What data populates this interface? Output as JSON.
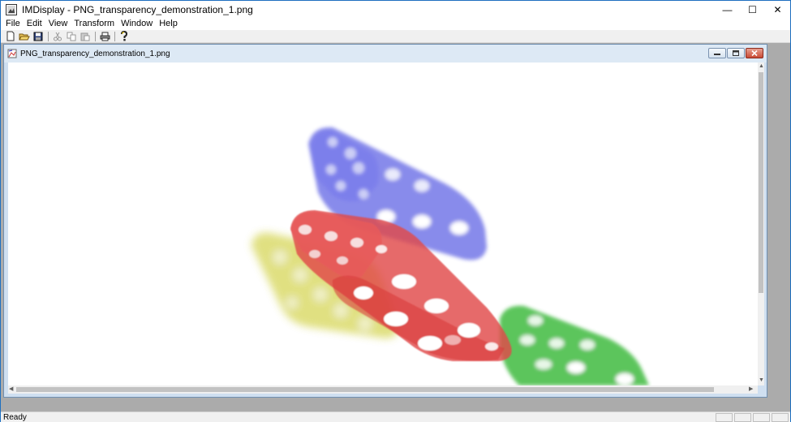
{
  "window": {
    "title": "IMDisplay - PNG_transparency_demonstration_1.png",
    "controls": {
      "minimize": "—",
      "maximize": "☐",
      "close": "✕"
    }
  },
  "menubar": {
    "items": [
      "File",
      "Edit",
      "View",
      "Transform",
      "Window",
      "Help"
    ]
  },
  "toolbar": {
    "buttons": [
      {
        "name": "new-icon"
      },
      {
        "name": "open-folder-icon"
      },
      {
        "name": "save-icon"
      },
      {
        "name": "cut-icon",
        "disabled": true
      },
      {
        "name": "copy-icon",
        "disabled": true
      },
      {
        "name": "paste-icon",
        "disabled": true
      },
      {
        "name": "print-icon"
      },
      {
        "name": "help-icon"
      }
    ]
  },
  "document": {
    "title": "PNG_transparency_demonstration_1.png",
    "image": {
      "description_colors": {
        "blue": "#5a5ee0",
        "red": "#e04848",
        "yellow": "#cccc30",
        "green": "#36b836"
      }
    }
  },
  "status": {
    "text": "Ready"
  }
}
